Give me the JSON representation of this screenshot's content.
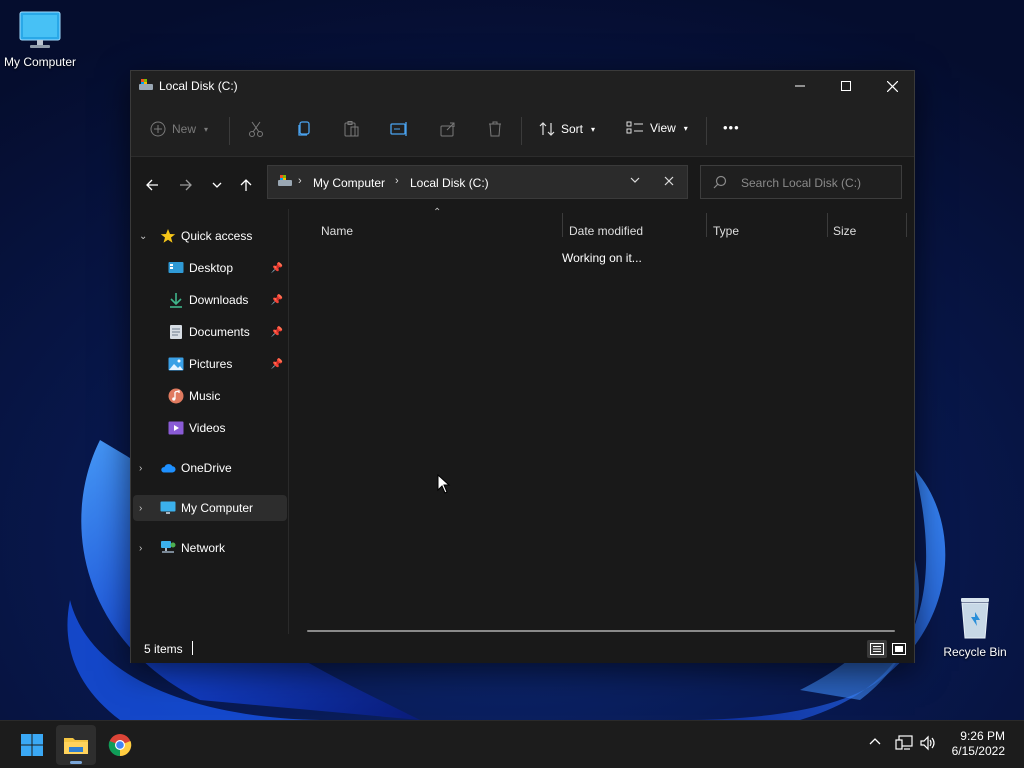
{
  "desktop": {
    "icons": [
      {
        "label": "My Computer"
      },
      {
        "label": "Recycle Bin"
      }
    ]
  },
  "window": {
    "title": "Local Disk (C:)",
    "controls": {
      "minimize": "—",
      "maximize": "☐",
      "close": "✕"
    }
  },
  "toolbar": {
    "new_label": "New",
    "sort_label": "Sort",
    "view_label": "View",
    "more_label": "•••"
  },
  "address": {
    "crumbs": [
      "My Computer",
      "Local Disk (C:)"
    ],
    "search_placeholder": "Search Local Disk (C:)"
  },
  "sidebar": {
    "quick_access": "Quick access",
    "pinned": [
      {
        "label": "Desktop",
        "icon": "desktop-folder-icon"
      },
      {
        "label": "Downloads",
        "icon": "downloads-folder-icon"
      },
      {
        "label": "Documents",
        "icon": "documents-folder-icon"
      },
      {
        "label": "Pictures",
        "icon": "pictures-folder-icon"
      },
      {
        "label": "Music",
        "icon": "music-folder-icon"
      },
      {
        "label": "Videos",
        "icon": "videos-folder-icon"
      }
    ],
    "onedrive": "OneDrive",
    "my_computer": "My Computer",
    "network": "Network"
  },
  "content": {
    "columns": [
      "Name",
      "Date modified",
      "Type",
      "Size"
    ],
    "status_message": "Working on it..."
  },
  "statusbar": {
    "item_count": "5 items"
  },
  "taskbar": {
    "time": "9:26 PM",
    "date": "6/15/2022"
  },
  "colors": {
    "accent": "#0078d4",
    "window_bg": "#191919",
    "taskbar_bg": "#1c1c1c"
  }
}
